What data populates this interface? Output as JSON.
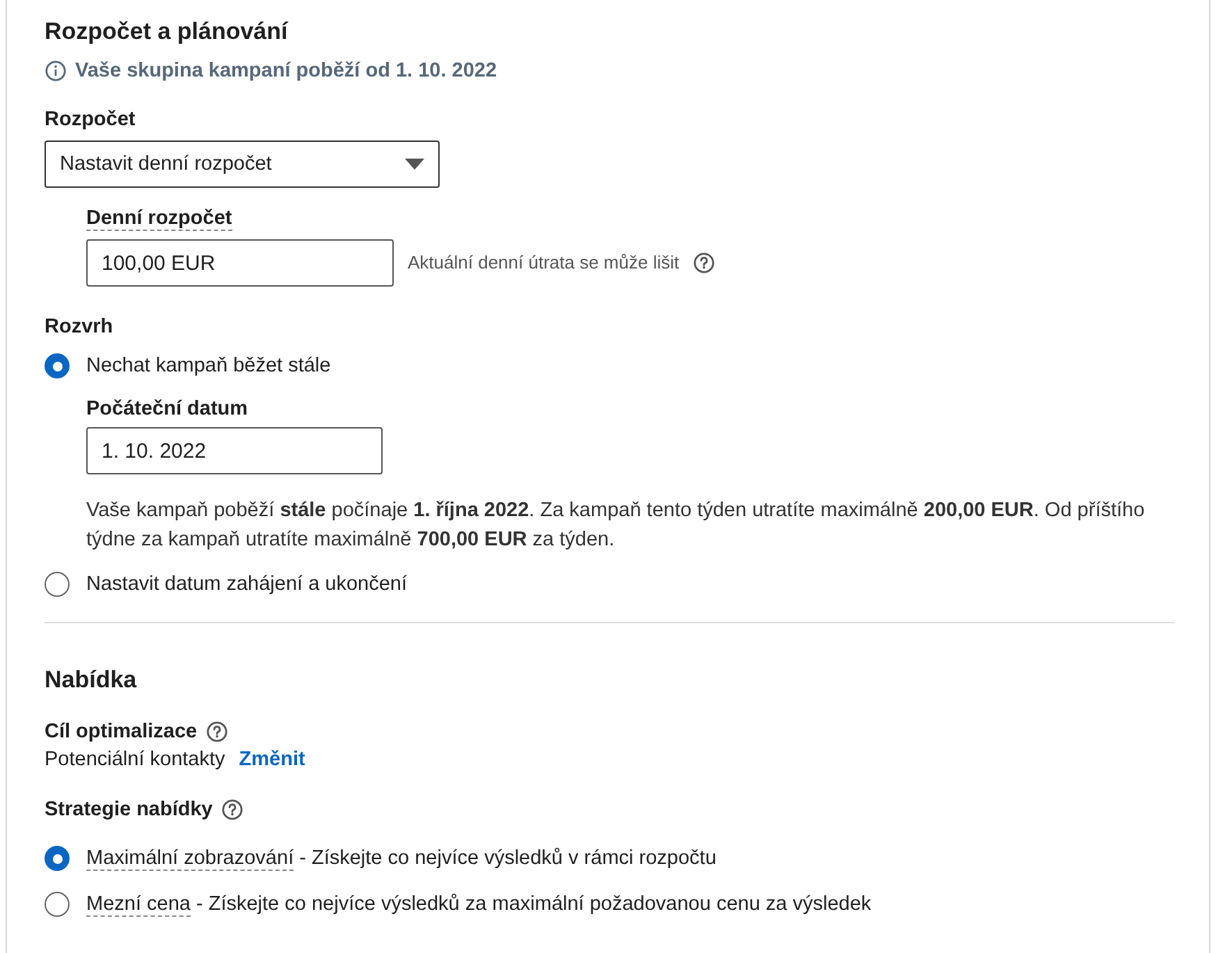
{
  "budget_section": {
    "title": "Rozpočet a plánování",
    "info": "Vaše skupina kampaní poběží od 1. 10. 2022",
    "budget": {
      "label": "Rozpočet",
      "select_value": "Nastavit denní rozpočet",
      "daily_label": "Denní rozpočet",
      "daily_value": "100,00 EUR",
      "hint": "Aktuální denní útrata se může lišit"
    },
    "schedule": {
      "label": "Rozvrh",
      "options": [
        {
          "label": "Nechat kampaň běžet stále",
          "selected": true,
          "start_label": "Počáteční datum",
          "start_value": "1. 10. 2022",
          "note": "Vaše kampaň poběží **stále** počínaje **1. října 2022**. Za kampaň tento týden utratíte maximálně **200,00 EUR**. Od příštího týdne za kampaň utratíte maximálně **700,00 EUR** za týden."
        },
        {
          "label": "Nastavit datum zahájení a ukončení",
          "selected": false
        }
      ]
    }
  },
  "bid_section": {
    "title": "Nabídka",
    "goal_label": "Cíl optimalizace",
    "goal_value": "Potenciální kontakty",
    "change_link": "Změnit",
    "strategy_label": "Strategie nabídky",
    "strategies": [
      {
        "name": "Maximální zobrazování",
        "description": " - Získejte co nejvíce výsledků v rámci rozpočtu",
        "selected": true
      },
      {
        "name": "Mezní cena",
        "description": " - Získejte co nejvíce výsledků za maximální požadovanou cenu za výsledek",
        "selected": false
      }
    ]
  }
}
